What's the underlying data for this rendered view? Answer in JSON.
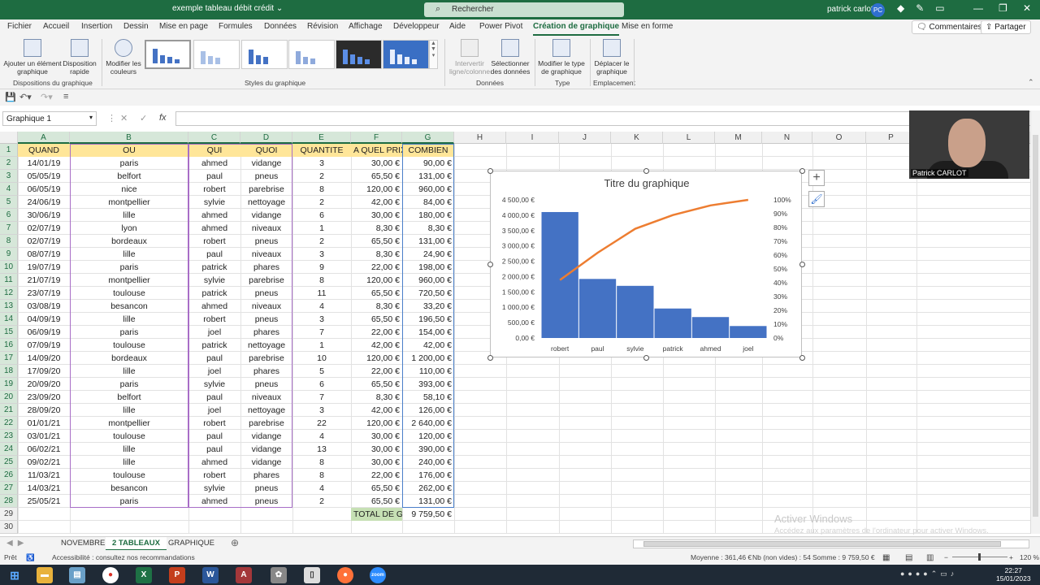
{
  "titlebar": {
    "document": "exemple tableau débit crédit ⌄",
    "search_placeholder": "Rechercher",
    "user": "patrick carlot",
    "user_initials": "PC"
  },
  "menu": [
    "Fichier",
    "Accueil",
    "Insertion",
    "Dessin",
    "Mise en page",
    "Formules",
    "Données",
    "Révision",
    "Affichage",
    "Développeur",
    "Aide",
    "Power Pivot",
    "Création de graphique",
    "Mise en forme"
  ],
  "menu_active": "Création de graphique",
  "comments_label": "Commentaires",
  "share_label": "Partager",
  "ribbon": {
    "add_element": "Ajouter un élément graphique",
    "quick_layout": "Disposition rapide",
    "change_colors": "Modifier les couleurs",
    "group_layouts": "Dispositions du graphique",
    "group_styles": "Styles du graphique",
    "switch_row_col": "Intervertir ligne/colonne",
    "select_data": "Sélectionner des données",
    "group_data": "Données",
    "change_type": "Modifier le type de graphique",
    "group_type": "Type",
    "move_chart": "Déplacer le graphique",
    "group_location": "Emplacement"
  },
  "namebox": "Graphique 1",
  "formula": "",
  "columns": [
    "A",
    "B",
    "C",
    "D",
    "E",
    "F",
    "G",
    "H",
    "I",
    "J",
    "K",
    "L",
    "M",
    "N",
    "O",
    "P"
  ],
  "headers": [
    "QUAND",
    "OU",
    "QUI",
    "QUOI",
    "QUANTITE",
    "A QUEL PRIX",
    "COMBIEN"
  ],
  "rows": [
    [
      "14/01/19",
      "paris",
      "ahmed",
      "vidange",
      "3",
      "30,00 €",
      "90,00 €"
    ],
    [
      "05/05/19",
      "belfort",
      "paul",
      "pneus",
      "2",
      "65,50 €",
      "131,00 €"
    ],
    [
      "06/05/19",
      "nice",
      "robert",
      "parebrise",
      "8",
      "120,00 €",
      "960,00 €"
    ],
    [
      "24/06/19",
      "montpellier",
      "sylvie",
      "nettoyage",
      "2",
      "42,00 €",
      "84,00 €"
    ],
    [
      "30/06/19",
      "lille",
      "ahmed",
      "vidange",
      "6",
      "30,00 €",
      "180,00 €"
    ],
    [
      "02/07/19",
      "lyon",
      "ahmed",
      "niveaux",
      "1",
      "8,30 €",
      "8,30 €"
    ],
    [
      "02/07/19",
      "bordeaux",
      "robert",
      "pneus",
      "2",
      "65,50 €",
      "131,00 €"
    ],
    [
      "08/07/19",
      "lille",
      "paul",
      "niveaux",
      "3",
      "8,30 €",
      "24,90 €"
    ],
    [
      "19/07/19",
      "paris",
      "patrick",
      "phares",
      "9",
      "22,00 €",
      "198,00 €"
    ],
    [
      "21/07/19",
      "montpellier",
      "sylvie",
      "parebrise",
      "8",
      "120,00 €",
      "960,00 €"
    ],
    [
      "23/07/19",
      "toulouse",
      "patrick",
      "pneus",
      "11",
      "65,50 €",
      "720,50 €"
    ],
    [
      "03/08/19",
      "besancon",
      "ahmed",
      "niveaux",
      "4",
      "8,30 €",
      "33,20 €"
    ],
    [
      "04/09/19",
      "lille",
      "robert",
      "pneus",
      "3",
      "65,50 €",
      "196,50 €"
    ],
    [
      "06/09/19",
      "paris",
      "joel",
      "phares",
      "7",
      "22,00 €",
      "154,00 €"
    ],
    [
      "07/09/19",
      "toulouse",
      "patrick",
      "nettoyage",
      "1",
      "42,00 €",
      "42,00 €"
    ],
    [
      "14/09/20",
      "bordeaux",
      "paul",
      "parebrise",
      "10",
      "120,00 €",
      "1 200,00 €"
    ],
    [
      "17/09/20",
      "lille",
      "joel",
      "phares",
      "5",
      "22,00 €",
      "110,00 €"
    ],
    [
      "20/09/20",
      "paris",
      "sylvie",
      "pneus",
      "6",
      "65,50 €",
      "393,00 €"
    ],
    [
      "23/09/20",
      "belfort",
      "paul",
      "niveaux",
      "7",
      "8,30 €",
      "58,10 €"
    ],
    [
      "28/09/20",
      "lille",
      "joel",
      "nettoyage",
      "3",
      "42,00 €",
      "126,00 €"
    ],
    [
      "01/01/21",
      "montpellier",
      "robert",
      "parebrise",
      "22",
      "120,00 €",
      "2 640,00 €"
    ],
    [
      "03/01/21",
      "toulouse",
      "paul",
      "vidange",
      "4",
      "30,00 €",
      "120,00 €"
    ],
    [
      "06/02/21",
      "lille",
      "paul",
      "vidange",
      "13",
      "30,00 €",
      "390,00 €"
    ],
    [
      "09/02/21",
      "lille",
      "ahmed",
      "vidange",
      "8",
      "30,00 €",
      "240,00 €"
    ],
    [
      "11/03/21",
      "toulouse",
      "robert",
      "phares",
      "8",
      "22,00 €",
      "176,00 €"
    ],
    [
      "14/03/21",
      "besancon",
      "sylvie",
      "pneus",
      "4",
      "65,50 €",
      "262,00 €"
    ],
    [
      "25/05/21",
      "paris",
      "ahmed",
      "pneus",
      "2",
      "65,50 €",
      "131,00 €"
    ]
  ],
  "total_label": "TOTAL DE G",
  "total_value": "9 759,50 €",
  "chart_data": {
    "type": "bar",
    "title": "Titre du graphique",
    "categories": [
      "robert",
      "paul",
      "sylvie",
      "patrick",
      "ahmed",
      "joel"
    ],
    "values": [
      4103.5,
      1923.9,
      1699,
      960.5,
      682.5,
      390
    ],
    "cumulative_pct": [
      42.0,
      61.7,
      79.1,
      89.0,
      96.0,
      100
    ],
    "ylim": [
      0,
      4500
    ],
    "y_ticks": [
      "0,00 €",
      "500,00 €",
      "1 000,00 €",
      "1 500,00 €",
      "2 000,00 €",
      "2 500,00 €",
      "3 000,00 €",
      "3 500,00 €",
      "4 000,00 €",
      "4 500,00 €"
    ],
    "y2_ticks": [
      "0%",
      "10%",
      "20%",
      "30%",
      "40%",
      "50%",
      "60%",
      "70%",
      "80%",
      "90%",
      "100%"
    ],
    "bar_color": "#4472c4",
    "line_color": "#ed7d31"
  },
  "webcam_label": "Patrick CARLOT",
  "activate": {
    "title": "Activer Windows",
    "subtitle": "Accédez aux paramètres de l'ordinateur pour activer Windows."
  },
  "sheets": [
    "NOVEMBRE",
    "2 TABLEAUX",
    "GRAPHIQUE"
  ],
  "active_sheet": "2 TABLEAUX",
  "status": {
    "ready": "Prêt",
    "accessibility": "Accessibilité : consultez nos recommandations",
    "average": "Moyenne : 361,46 €",
    "count": "Nb (non vides) : 54",
    "sum": "Somme : 9 759,50 €",
    "zoom": "120 %"
  },
  "clock": {
    "time": "22:27",
    "date": "15/01/2023"
  }
}
